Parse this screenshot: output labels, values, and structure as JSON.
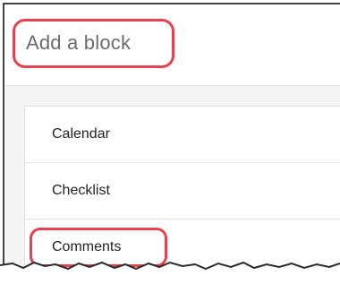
{
  "header": {
    "title": "Add a block"
  },
  "blocks": [
    {
      "label": "Calendar"
    },
    {
      "label": "Checklist"
    },
    {
      "label": "Comments"
    }
  ],
  "colors": {
    "highlight": "#e5414e",
    "panel_background": "#f4f4f4",
    "header_text": "#6b6b6b"
  }
}
